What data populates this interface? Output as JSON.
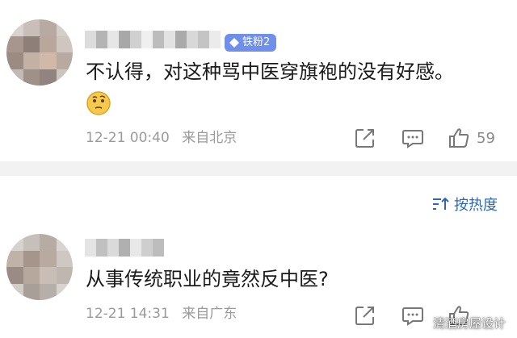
{
  "colors": {
    "link_blue": "#2f66b8",
    "meta_gray": "#9a9a9a",
    "badge_bg": "#6f8fe8",
    "divider": "#f2f2f2"
  },
  "sort": {
    "label": "按热度",
    "icon": "sort-icon"
  },
  "comments": [
    {
      "badge": "铁粉2",
      "text": "不认得，对这种骂中医穿旗袍的没有好感。",
      "has_emoji": true,
      "time": "12-21 00:40",
      "location": "来自北京",
      "likes": "59"
    },
    {
      "text": "从事传统职业的竟然反中医?",
      "time": "12-21 14:31",
      "location": "来自广东"
    }
  ],
  "watermark": "清酒房屋设计"
}
